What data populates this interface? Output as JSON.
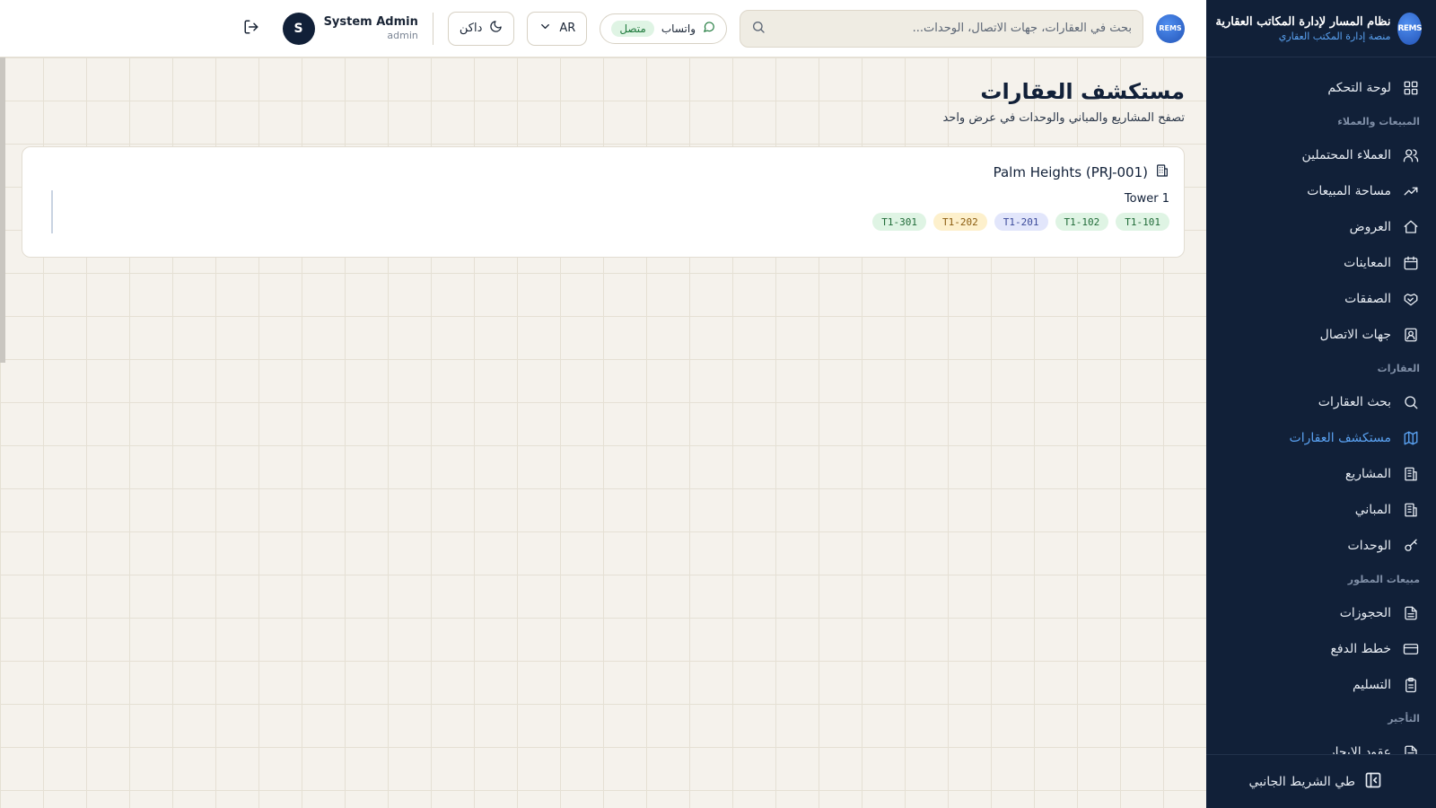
{
  "sidebar": {
    "brand_logo_text": "REMS",
    "brand_title": "نظام المسار لإدارة المكاتب العقارية",
    "brand_subtitle": "منصة إدارة المكتب العقاري",
    "items": [
      {
        "type": "item",
        "label": "لوحة التحكم",
        "icon": "dashboard-icon"
      },
      {
        "type": "section",
        "label": "المبيعات والعملاء"
      },
      {
        "type": "item",
        "label": "العملاء المحتملين",
        "icon": "users-icon"
      },
      {
        "type": "item",
        "label": "مساحة المبيعات",
        "icon": "trend-icon"
      },
      {
        "type": "item",
        "label": "العروض",
        "icon": "home-icon"
      },
      {
        "type": "item",
        "label": "المعاينات",
        "icon": "calendar-icon"
      },
      {
        "type": "item",
        "label": "الصفقات",
        "icon": "handshake-icon"
      },
      {
        "type": "item",
        "label": "جهات الاتصال",
        "icon": "contact-icon"
      },
      {
        "type": "section",
        "label": "العقارات"
      },
      {
        "type": "item",
        "label": "بحث العقارات",
        "icon": "search-icon"
      },
      {
        "type": "item",
        "label": "مستكشف العقارات",
        "icon": "map-icon",
        "active": true
      },
      {
        "type": "item",
        "label": "المشاريع",
        "icon": "building-icon"
      },
      {
        "type": "item",
        "label": "المباني",
        "icon": "building-icon"
      },
      {
        "type": "item",
        "label": "الوحدات",
        "icon": "key-icon"
      },
      {
        "type": "section",
        "label": "مبيعات المطور"
      },
      {
        "type": "item",
        "label": "الحجوزات",
        "icon": "document-icon"
      },
      {
        "type": "item",
        "label": "خطط الدفع",
        "icon": "card-icon"
      },
      {
        "type": "item",
        "label": "التسليم",
        "icon": "clipboard-icon"
      },
      {
        "type": "section",
        "label": "التأجير"
      },
      {
        "type": "item",
        "label": "عقود الإيجار",
        "icon": "document-icon"
      }
    ],
    "collapse_label": "طي الشريط الجانبي"
  },
  "header": {
    "logo_text": "REMS",
    "search_placeholder": "بحث في العقارات، جهات الاتصال، الوحدات...",
    "whatsapp_label": "واتساب",
    "whatsapp_status": "متصل",
    "language_label": "AR",
    "theme_label": "داكن",
    "user_name": "System Admin",
    "user_role": "admin",
    "avatar_initial": "S"
  },
  "main": {
    "title": "مستكشف العقارات",
    "subtitle": "تصفح المشاريع والمباني والوحدات في عرض واحد",
    "project": {
      "name": "Palm Heights (PRJ-001)",
      "building": "Tower 1",
      "units": [
        {
          "code": "T1-101",
          "status": "green"
        },
        {
          "code": "T1-102",
          "status": "green"
        },
        {
          "code": "T1-201",
          "status": "blue"
        },
        {
          "code": "T1-202",
          "status": "amber"
        },
        {
          "code": "T1-301",
          "status": "green"
        }
      ]
    }
  },
  "colors": {
    "sidebar_bg": "#112038",
    "accent": "#5aa2f2",
    "available": "#dff4e4",
    "reserved": "#e2e6fb",
    "hold": "#fdf0cc"
  }
}
